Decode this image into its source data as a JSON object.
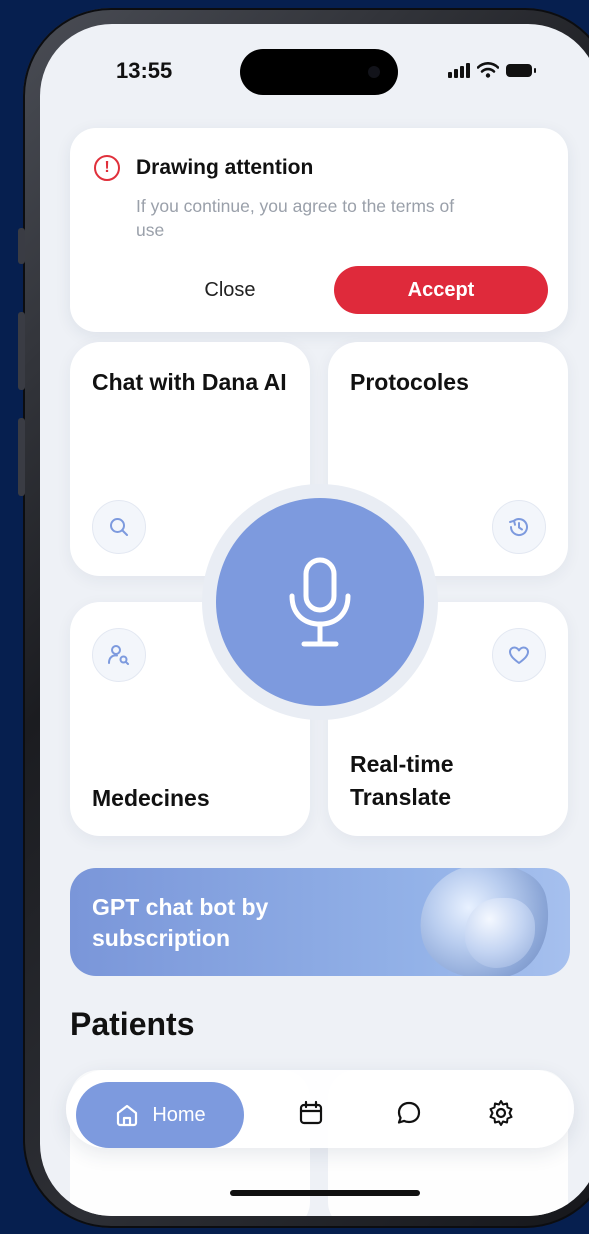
{
  "status_bar": {
    "time": "13:55"
  },
  "alert": {
    "title": "Drawing attention",
    "body": "If you continue, you agree to the terms of use",
    "close_label": "Close",
    "accept_label": "Accept"
  },
  "tiles": {
    "chat": "Chat with Dana AI",
    "protocols": "Protocoles",
    "medicines": "Medecines",
    "translate": "Real-time Translate"
  },
  "promo": {
    "text": "GPT chat bot by subscription"
  },
  "patients": {
    "title": "Patients"
  },
  "tab_bar": {
    "home_label": "Home"
  },
  "colors": {
    "accent": "#7d9ade",
    "danger": "#df2a3b",
    "background": "#eef1f6",
    "frame_background": "#061f4f"
  },
  "icons": {
    "alert": "alert-circle-icon",
    "chat": "search-icon",
    "protocols": "history-icon",
    "medicines": "user-search-icon",
    "translate": "heart-icon",
    "mic": "microphone-icon",
    "tabs": [
      "home-icon",
      "calendar-icon",
      "chat-bubble-icon",
      "gear-icon"
    ]
  }
}
